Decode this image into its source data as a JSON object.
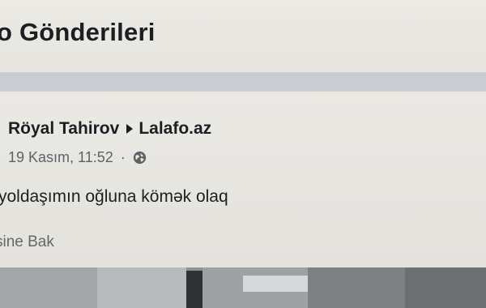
{
  "section": {
    "title": "o Gönderileri"
  },
  "post": {
    "author": "Röyal Tahirov",
    "target_page": "Lalafo.az",
    "timestamp": "19 Kasım, 11:52",
    "separator": "·",
    "privacy_icon": "globe-icon",
    "text": "yoldaşımın oğluna kömək olaq",
    "see_translation": "sine Bak"
  },
  "colors": {
    "text_primary": "#1c1e21",
    "text_secondary": "#65676b",
    "feed_background": "#c9ccd0"
  }
}
